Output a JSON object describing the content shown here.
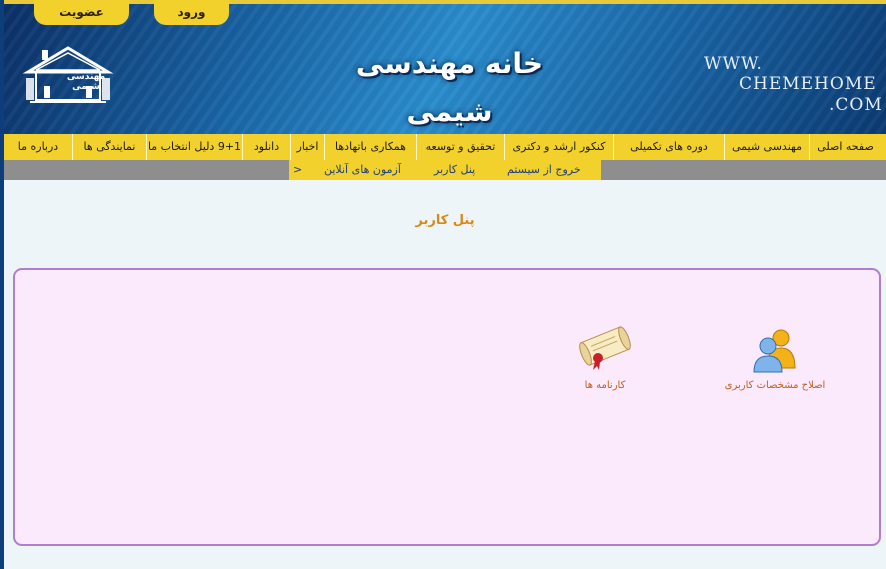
{
  "header": {
    "tabs": {
      "register": "عضویت",
      "login": "ورود"
    },
    "site_title": "خانه مهندسی شیمی",
    "url_line1": "WWW.",
    "url_line2": "CHEMEHOME",
    "url_line3": ".COM",
    "logo_text": "مهندسی شیمی"
  },
  "nav": {
    "items": [
      {
        "label": "صفحه اصلی"
      },
      {
        "label": "مهندسی شیمی"
      },
      {
        "label": "دوره های تکمیلی"
      },
      {
        "label": "کنکور ارشد و دکتری"
      },
      {
        "label": "تحقیق و توسعه"
      },
      {
        "label": "همکاری باتهادها"
      },
      {
        "label": "اخبار"
      },
      {
        "label": "دانلود"
      },
      {
        "label": "9+1 دلیل انتخاب ما"
      },
      {
        "label": "نمایندگی ها"
      },
      {
        "label": "درباره ما"
      }
    ]
  },
  "subnav": {
    "logout": "خروج از سیستم",
    "user_panel": "پنل کاربر",
    "online_exams": "آزمون های آنلاین",
    "arrow": ">"
  },
  "page": {
    "title": "پنل کاربر"
  },
  "panel": {
    "edit_profile": {
      "label": "اصلاح مشخصات کاربری",
      "icon": "users-icon"
    },
    "report_cards": {
      "label": "کارنامه ها",
      "icon": "scroll-certificate-icon"
    }
  },
  "colors": {
    "accent_yellow": "#f2d12c",
    "header_blue": "#1a67a8",
    "panel_bg": "#fbe9fc",
    "panel_border": "#b07fcc",
    "title_orange": "#d98a12"
  }
}
